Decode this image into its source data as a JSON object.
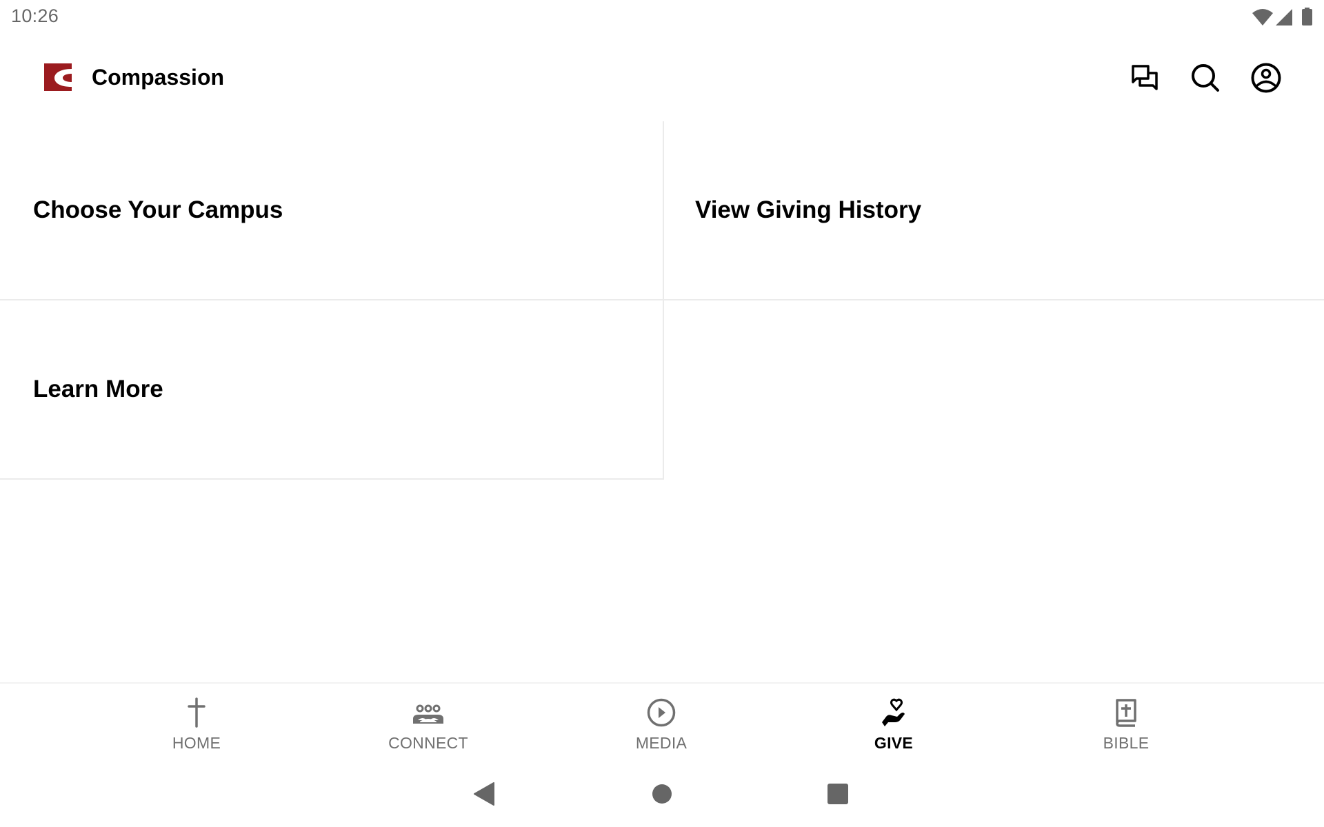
{
  "status_bar": {
    "time": "10:26",
    "icons": [
      "wifi-icon",
      "cell-signal-icon",
      "battery-icon"
    ]
  },
  "header": {
    "app_title": "Compassion",
    "logo_color": "#9b1b1f",
    "actions": [
      {
        "name": "messages",
        "icon": "chat-bubbles-icon"
      },
      {
        "name": "search",
        "icon": "search-icon"
      },
      {
        "name": "account",
        "icon": "account-circle-icon"
      }
    ]
  },
  "main": {
    "tiles": [
      {
        "label": "Choose Your Campus"
      },
      {
        "label": "View Giving History"
      },
      {
        "label": "Learn More"
      }
    ]
  },
  "bottom_nav": {
    "active_index": 3,
    "items": [
      {
        "label": "HOME",
        "icon": "cross-icon"
      },
      {
        "label": "CONNECT",
        "icon": "group-icon"
      },
      {
        "label": "MEDIA",
        "icon": "play-circle-icon"
      },
      {
        "label": "GIVE",
        "icon": "hand-heart-icon"
      },
      {
        "label": "BIBLE",
        "icon": "bible-icon"
      }
    ]
  },
  "system_nav": {
    "buttons": [
      "back",
      "home",
      "recents"
    ]
  },
  "colors": {
    "brand": "#9b1b1f",
    "nav_inactive": "#707070",
    "nav_active": "#000000",
    "divider": "#ebebeb",
    "system_gray": "#666666"
  }
}
